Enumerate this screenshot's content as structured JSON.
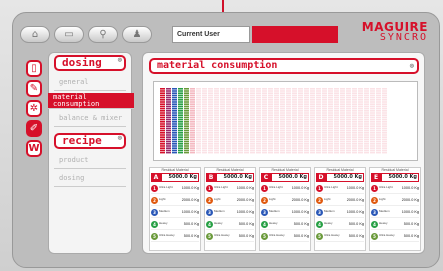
{
  "header": {
    "current_user_label": "Current User",
    "current_user_value": "",
    "logo_primary": "MAGUIRE",
    "logo_secondary": "SYNCRO",
    "nav_icons": [
      "home-icon",
      "chat-icon",
      "search-icon",
      "user-icon"
    ]
  },
  "rail": [
    {
      "icon": "panel-icon",
      "glyph": "▯",
      "active": false
    },
    {
      "icon": "wrench-icon",
      "glyph": "✎",
      "active": false
    },
    {
      "icon": "gear-icon",
      "glyph": "✲",
      "active": false
    },
    {
      "icon": "tools-icon",
      "glyph": "✐",
      "active": true
    },
    {
      "icon": "bin-icon",
      "glyph": "W",
      "active": false
    }
  ],
  "menu": {
    "sections": [
      {
        "title": "dosing",
        "items": [
          "general",
          "material consumption",
          "balance & mixer"
        ],
        "selected": 1
      },
      {
        "title": "recipe",
        "items": [
          "product",
          "dosing"
        ],
        "selected": -1
      }
    ]
  },
  "main": {
    "title": "material consumption"
  },
  "bins": [
    {
      "caption": "Residual Material",
      "letter": "A",
      "total": "5000.0 Kg",
      "rows": [
        {
          "n": "1",
          "label": "Ultra Light",
          "value": "1000.0 Kg"
        },
        {
          "n": "2",
          "label": "Light",
          "value": "2000.0 Kg"
        },
        {
          "n": "3",
          "label": "Medium",
          "value": "1000.0 Kg"
        },
        {
          "n": "4",
          "label": "Heavy",
          "value": "500.0 Kg"
        },
        {
          "n": "5",
          "label": "Ultra Heavy",
          "value": "500.0 Kg"
        }
      ]
    },
    {
      "caption": "Residual Material",
      "letter": "B",
      "total": "5000.0 Kg",
      "rows": [
        {
          "n": "1",
          "label": "Ultra Light",
          "value": "1000.0 Kg"
        },
        {
          "n": "2",
          "label": "Light",
          "value": "2000.0 Kg"
        },
        {
          "n": "3",
          "label": "Medium",
          "value": "1000.0 Kg"
        },
        {
          "n": "4",
          "label": "Heavy",
          "value": "500.0 Kg"
        },
        {
          "n": "5",
          "label": "Ultra Heavy",
          "value": "500.0 Kg"
        }
      ]
    },
    {
      "caption": "Residual Material",
      "letter": "C",
      "total": "5000.0 Kg",
      "rows": [
        {
          "n": "1",
          "label": "Ultra Light",
          "value": "1000.0 Kg"
        },
        {
          "n": "2",
          "label": "Light",
          "value": "2000.0 Kg"
        },
        {
          "n": "3",
          "label": "Medium",
          "value": "1000.0 Kg"
        },
        {
          "n": "4",
          "label": "Heavy",
          "value": "500.0 Kg"
        },
        {
          "n": "5",
          "label": "Ultra Heavy",
          "value": "500.0 Kg"
        }
      ]
    },
    {
      "caption": "Residual Material",
      "letter": "D",
      "total": "5000.0 Kg",
      "rows": [
        {
          "n": "1",
          "label": "Ultra Light",
          "value": "1000.0 Kg"
        },
        {
          "n": "2",
          "label": "Light",
          "value": "2000.0 Kg"
        },
        {
          "n": "3",
          "label": "Medium",
          "value": "1000.0 Kg"
        },
        {
          "n": "4",
          "label": "Heavy",
          "value": "500.0 Kg"
        },
        {
          "n": "5",
          "label": "Ultra Heavy",
          "value": "500.0 Kg"
        }
      ]
    },
    {
      "caption": "Residual Material",
      "letter": "E",
      "total": "5000.0 Kg",
      "rows": [
        {
          "n": "1",
          "label": "Ultra Light",
          "value": "1000.0 Kg"
        },
        {
          "n": "2",
          "label": "Light",
          "value": "2000.0 Kg"
        },
        {
          "n": "3",
          "label": "Medium",
          "value": "1000.0 Kg"
        },
        {
          "n": "4",
          "label": "Heavy",
          "value": "500.0 Kg"
        },
        {
          "n": "5",
          "label": "Ultra Heavy",
          "value": "500.0 Kg"
        }
      ]
    }
  ],
  "row_colors": [
    "#d6102a",
    "#e05a10",
    "#2a58b8",
    "#27a045",
    "#6a9a3a"
  ],
  "consumption_table": {
    "column_colors": [
      "#d6102a",
      "#9a2a6a",
      "#2a58b8",
      "#27a045",
      "#6a9a3a",
      "#f4b8c0"
    ],
    "filled_columns": 6,
    "total_columns": 38,
    "rows": 30
  },
  "colors": {
    "accent": "#d6102a",
    "panel": "#f7f7f7"
  }
}
